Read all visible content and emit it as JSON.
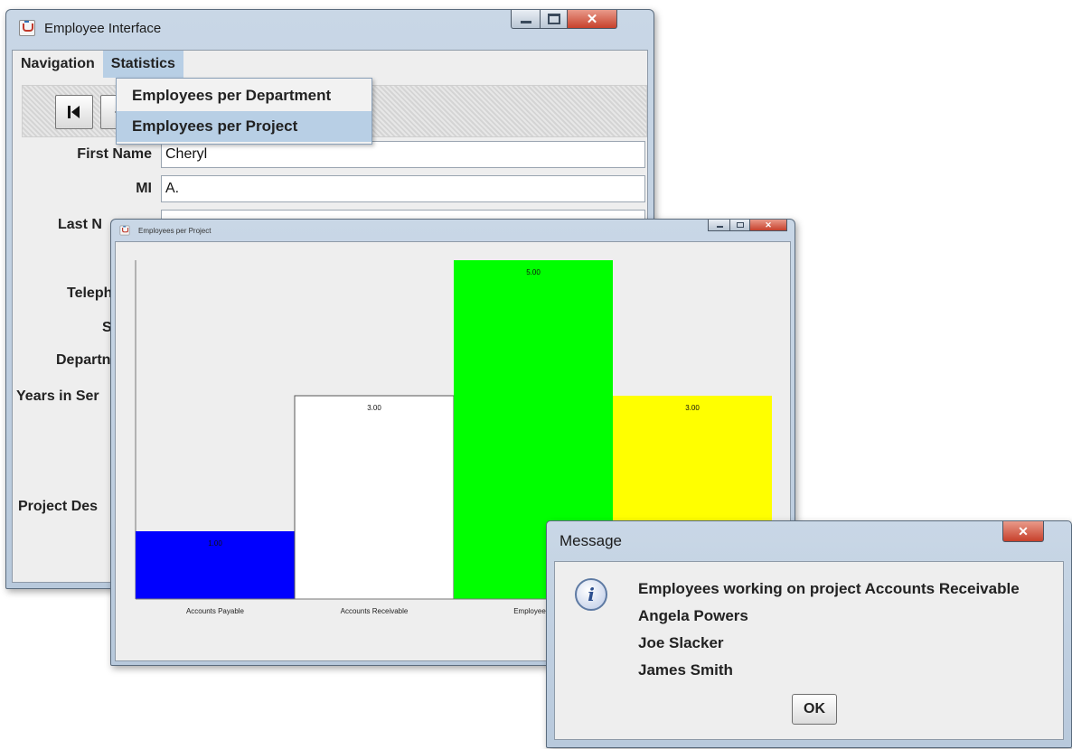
{
  "employee_window": {
    "title": "Employee Interface",
    "menus": [
      "Navigation",
      "Statistics"
    ],
    "popup_items": [
      "Employees per Department",
      "Employees per Project"
    ],
    "form": {
      "first_name_label": "First Name",
      "first_name_value": "Cheryl",
      "mi_label": "MI",
      "mi_value": "A.",
      "last_name_label": "Last N",
      "telephone_label": "Teleph",
      "salary_label": "Sa",
      "department_label": "Departn",
      "years_label": "Years in Ser",
      "project_desc_label": "Project Des"
    }
  },
  "chart_window": {
    "title": "Employees per Project"
  },
  "chart_data": {
    "type": "bar",
    "categories": [
      "Accounts Payable",
      "Accounts Receivable",
      "Employee R",
      ""
    ],
    "values": [
      1.0,
      3.0,
      5.0,
      3.0
    ],
    "value_labels": [
      "1.00",
      "3.00",
      "5.00",
      "3.00"
    ],
    "colors": [
      "#0000ff",
      "#ffffff",
      "#00ff00",
      "#ffff00"
    ],
    "ylim": [
      0,
      5
    ],
    "grid": false,
    "legend": "none"
  },
  "message_dialog": {
    "title": "Message",
    "lines": [
      "Employees working on project Accounts Receivable",
      "Angela Powers",
      "Joe Slacker",
      "James Smith"
    ],
    "ok_label": "OK"
  },
  "colors": {
    "menu_highlight": "#b8cfe5",
    "close_button": "#c7412c"
  }
}
